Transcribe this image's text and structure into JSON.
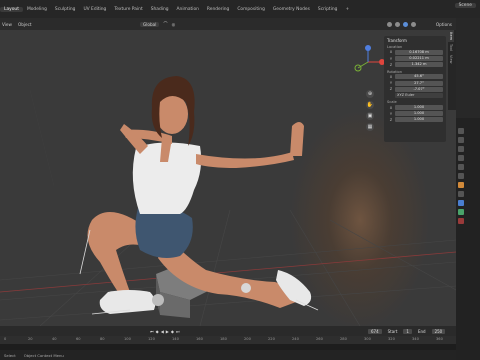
{
  "workspace_tabs": [
    "Layout",
    "Modeling",
    "Sculpting",
    "UV Editing",
    "Texture Paint",
    "Shading",
    "Animation",
    "Rendering",
    "Compositing",
    "Geometry Nodes",
    "Scripting",
    "+"
  ],
  "active_tab": "Layout",
  "scene_label": "Scene",
  "viewport_header": {
    "left_buttons": [
      "View",
      "Object"
    ],
    "orientation_value": "Global",
    "options_label": "Options"
  },
  "transform_panel": {
    "title": "Transform",
    "location_label": "Location",
    "location": [
      {
        "axis": "X",
        "value": "0.16708 m"
      },
      {
        "axis": "Y",
        "value": "0.02211 m"
      },
      {
        "axis": "Z",
        "value": "1.342 m"
      }
    ],
    "rotation_label": "Rotation",
    "rotation": [
      {
        "axis": "X",
        "value": "45.6°"
      },
      {
        "axis": "Y",
        "value": "27.7°"
      },
      {
        "axis": "Z",
        "value": "-7.07°"
      }
    ],
    "rotation_mode": "XYZ Euler",
    "scale_label": "Scale",
    "scale": [
      {
        "axis": "X",
        "value": "1.000"
      },
      {
        "axis": "Y",
        "value": "1.000"
      },
      {
        "axis": "Z",
        "value": "1.000"
      }
    ]
  },
  "side_tabs": [
    "Item",
    "Tool",
    "View"
  ],
  "timeline": {
    "current_frame": "674",
    "start_label": "Start",
    "start_value": "1",
    "end_label": "End",
    "end_value": "250",
    "ruler_ticks": [
      "0",
      "20",
      "40",
      "60",
      "80",
      "100",
      "120",
      "140",
      "160",
      "180",
      "200",
      "220",
      "240",
      "260",
      "280",
      "300",
      "320",
      "340",
      "360"
    ]
  },
  "status_bar": {
    "left": "Select",
    "middle": "Object Context Menu"
  },
  "colors": {
    "viewport_bg": "#393939",
    "accent_blue": "#5b8ed8",
    "gizmo_x": "#e0453d",
    "gizmo_y": "#79b036",
    "gizmo_z": "#4f7ee0"
  }
}
